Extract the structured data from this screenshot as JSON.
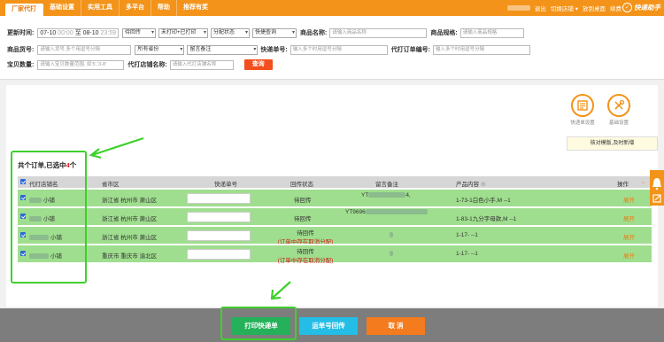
{
  "topbar": {
    "nav": [
      "厂家代打",
      "基础设置",
      "实用工具",
      "多平台",
      "帮助",
      "推荐有奖"
    ],
    "right_links": [
      "退出",
      "切换店铺",
      "放到桌面",
      "续费"
    ],
    "logo": "快递助手"
  },
  "filters": {
    "update_time_label": "更新时间:",
    "date_from": "07-10",
    "date_from_time": "00:00",
    "date_to_word": "至",
    "date_to": "08-10",
    "date_to_time": "23:59",
    "status_select": "待回传",
    "print_select": "未打印+已打印",
    "alloc_select": "分配状态",
    "quick_select": "快捷查询",
    "product_name_label": "商品名称:",
    "product_name_placeholder": "请输入商品名称",
    "product_spec_label": "商品规格:",
    "product_spec_placeholder": "请输入商品规格",
    "sku_label": "商品货号:",
    "sku_placeholder": "请输入货号,多个用逗号分隔",
    "province_select": "所有省份",
    "remark_select": "留言备注",
    "tracking_label": "快递单号:",
    "tracking_placeholder": "输入多个时用逗号分隔",
    "order_no_label": "代打订单编号:",
    "order_no_placeholder": "输入多个时用逗号分隔",
    "qty_label": "宝贝数量:",
    "qty_placeholder": "请输入宝贝数量范围, 如'5','3-8'",
    "shop_label": "代打店铺名称:",
    "shop_placeholder": "请输入代打店铺名称",
    "query_button": "查询"
  },
  "tools": {
    "waybill_settings": "快递单设置",
    "basic_settings": "基础设置",
    "tip": "核对模版,及时新增"
  },
  "summary": {
    "prefix": "共个订单,已选中",
    "selected": "4",
    "suffix": "个"
  },
  "table": {
    "headers": [
      "代打店铺名",
      "省市区",
      "快递单号",
      "回传状态",
      "留言备注",
      "产品内容",
      "操作"
    ],
    "rows": [
      {
        "shop_suffix": "小铺",
        "region": "浙江省 杭州市 萧山区",
        "status": "待回传",
        "status_note": "",
        "remark": "YT",
        "remark_suffix": "4,",
        "product": "1-73-1白色小手,M --1",
        "op": "展开"
      },
      {
        "shop_suffix": "小铺",
        "region": "浙江省 杭州市 萧山区",
        "status": "待回传",
        "status_note": "",
        "remark": "YT9696",
        "remark_suffix": "",
        "product": "1-83-1九分字母款,M --1",
        "op": "展开"
      },
      {
        "shop_suffix": "小铺",
        "region": "浙江省 杭州市 萧山区",
        "status": "待回传",
        "status_note": "(订单中存在取消分配)",
        "remark": "",
        "remark_suffix": "",
        "product": "1-17- --1",
        "op": "展开"
      },
      {
        "shop_suffix": "小铺",
        "region": "重庆市 重庆市 渝北区",
        "status": "待回传",
        "status_note": "(订单中存在取消分配)",
        "remark": "",
        "remark_suffix": "",
        "product": "1-17- --1",
        "op": "展开"
      }
    ]
  },
  "footer": {
    "print_button": "打印快递单",
    "return_button": "运单号回传",
    "cancel_button": "取 消"
  },
  "colors": {
    "brand_orange": "#f39319",
    "row_green": "#9fde8e",
    "highlight_green": "#3fd02c",
    "print_green": "#25b05a",
    "return_cyan": "#23bde6",
    "cancel_orange": "#f47b1e"
  }
}
